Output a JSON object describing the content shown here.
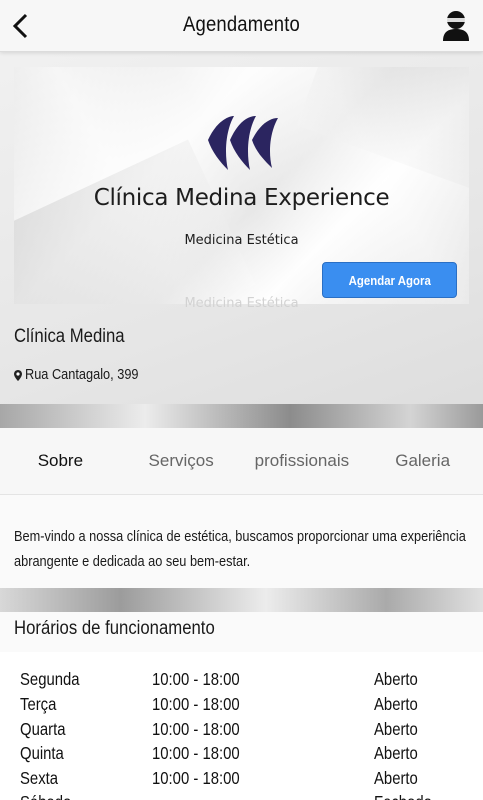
{
  "header": {
    "title": "Agendamento"
  },
  "hero": {
    "logo_title": "Clínica Medina Experience",
    "logo_subtitle": "Medicina Estética",
    "book_label": "Agendar Agora",
    "ghost_text": "Medicina Estética"
  },
  "clinic": {
    "name": "Clínica Medina",
    "address": "Rua Cantagalo, 399"
  },
  "tabs": [
    {
      "label": "Sobre"
    },
    {
      "label": "Serviços"
    },
    {
      "label": "profissionais"
    },
    {
      "label": "Galeria"
    }
  ],
  "about": {
    "text": "Bem-vindo a nossa clínica de estética, buscamos proporcionar uma experiência abrangente e dedicada ao seu bem-estar."
  },
  "hours": {
    "title": "Horários de funcionamento",
    "rows": [
      {
        "day": "Segunda",
        "time": "10:00 - 18:00",
        "status": "Aberto"
      },
      {
        "day": "Terça",
        "time": "10:00 - 18:00",
        "status": "Aberto"
      },
      {
        "day": "Quarta",
        "time": "10:00 - 18:00",
        "status": "Aberto"
      },
      {
        "day": "Quinta",
        "time": "10:00 - 18:00",
        "status": "Aberto"
      },
      {
        "day": "Sexta",
        "time": "10:00 - 18:00",
        "status": "Aberto"
      },
      {
        "day": "Sábado",
        "time": "",
        "status": "Fechado"
      }
    ]
  },
  "colors": {
    "accent": "#3a8ef0",
    "logo": "#2b2560"
  },
  "icons": {
    "back": "chevron-left-icon",
    "profile": "user-icon",
    "pin": "map-pin-icon"
  }
}
